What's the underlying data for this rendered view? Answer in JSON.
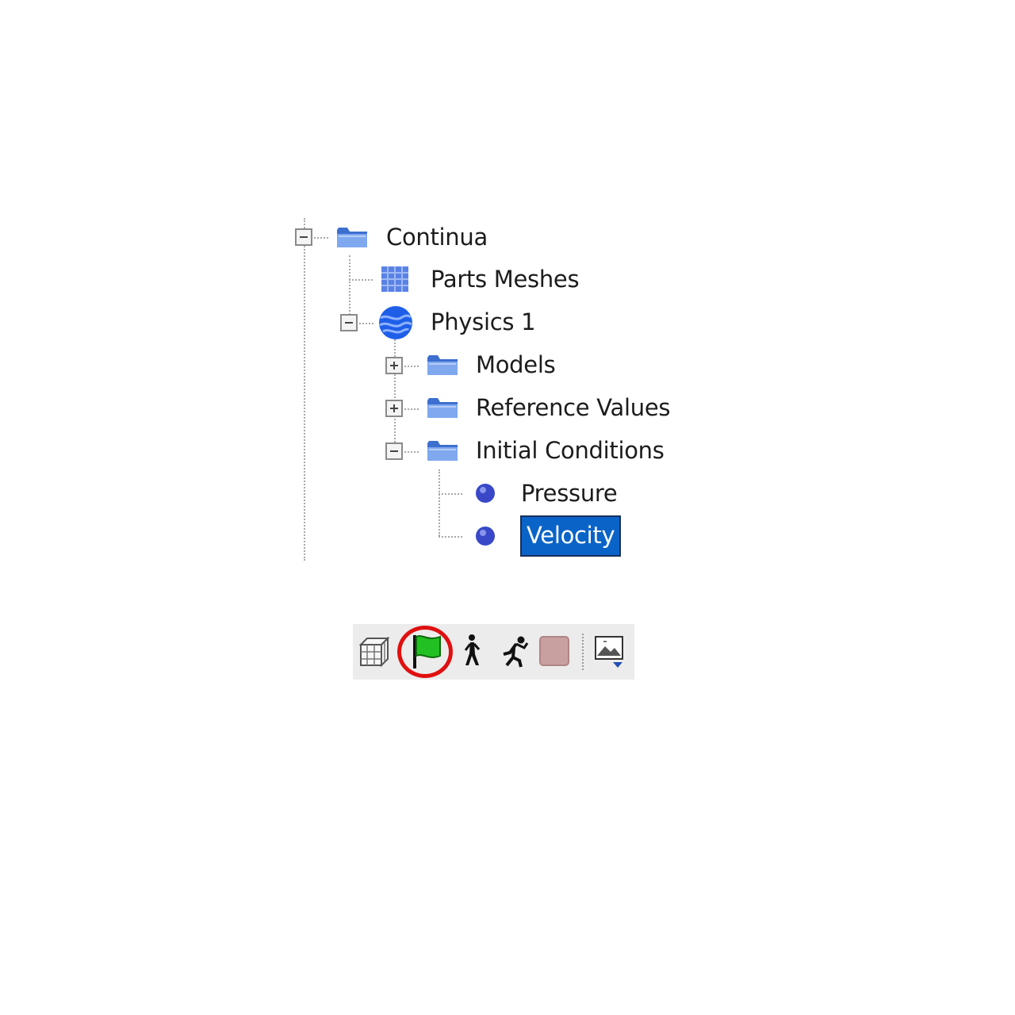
{
  "tree": {
    "nodes": [
      {
        "label": "Continua",
        "icon": "folder-icon",
        "state": "expanded"
      },
      {
        "label": "Parts Meshes",
        "icon": "mesh-grid-icon",
        "state": "leaf"
      },
      {
        "label": "Physics 1",
        "icon": "physics-sphere-icon",
        "state": "expanded"
      },
      {
        "label": "Models",
        "icon": "folder-icon",
        "state": "collapsed"
      },
      {
        "label": "Reference Values",
        "icon": "folder-icon",
        "state": "collapsed"
      },
      {
        "label": "Initial Conditions",
        "icon": "folder-icon",
        "state": "expanded"
      },
      {
        "label": "Pressure",
        "icon": "condition-dot-icon",
        "state": "leaf"
      },
      {
        "label": "Velocity",
        "icon": "condition-dot-icon",
        "state": "leaf",
        "selected": true
      }
    ]
  },
  "toolbar": {
    "buttons": [
      {
        "name": "mesh-cube-icon"
      },
      {
        "name": "initialize-flag-icon",
        "highlighted": true
      },
      {
        "name": "step-walk-icon"
      },
      {
        "name": "run-icon"
      },
      {
        "name": "stop-icon"
      },
      {
        "name": "scene-dropdown-icon"
      }
    ],
    "highlight_color": "#e01010"
  },
  "colors": {
    "selection": "#0a64c8",
    "folder": "#5b8fe0",
    "flag": "#22c022"
  }
}
